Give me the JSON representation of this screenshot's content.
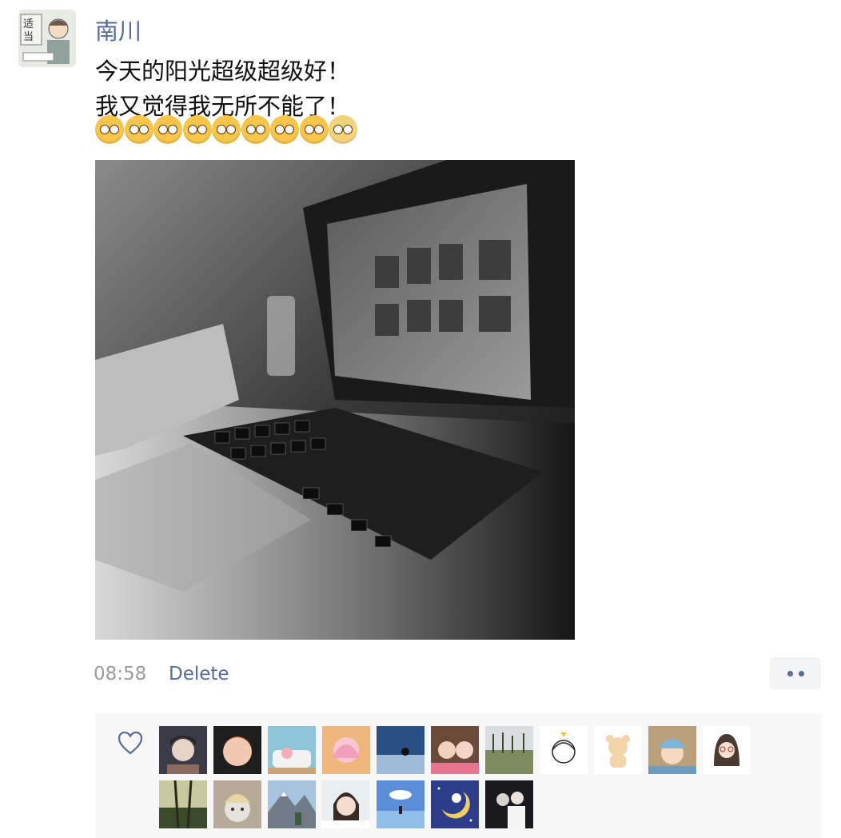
{
  "post": {
    "username": "南川",
    "lines": [
      "今天的阳光超级超级好！",
      "我又觉得我无所不能了！"
    ],
    "emojis": [
      "flushed-emoji",
      "kissing-emoji",
      "tongue-out-emoji",
      "thinking-emoji",
      "saluting-emoji",
      "smirk-emoji",
      "party-emoji",
      "sleepy-emoji",
      "cat-emoji"
    ],
    "photo_icon": "laptop-photo",
    "timestamp": "08:58",
    "delete_label": "Delete"
  },
  "likes": {
    "icon": "heart-outline-icon",
    "avatars": [
      "avatar-1",
      "avatar-2",
      "avatar-3",
      "avatar-4",
      "avatar-5",
      "avatar-6",
      "avatar-7",
      "avatar-8",
      "avatar-9",
      "avatar-10",
      "avatar-11",
      "avatar-12",
      "avatar-13",
      "avatar-14",
      "avatar-15",
      "avatar-16",
      "avatar-17",
      "avatar-18"
    ]
  },
  "colors": {
    "link": "#576b95",
    "timestamp": "#9b9b9b"
  }
}
